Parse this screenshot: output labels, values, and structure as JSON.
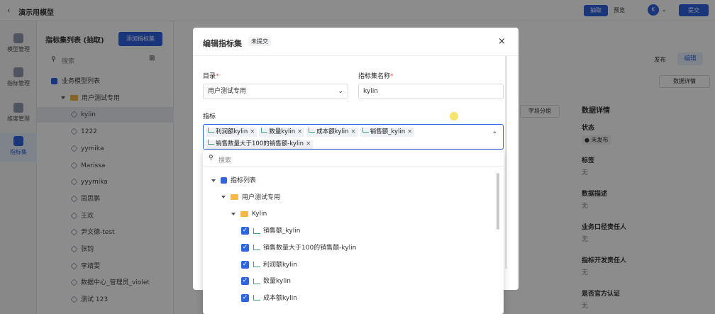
{
  "app": {
    "back_label": "演示用模型",
    "btn_draw": "抽取",
    "btn_preview": "预览",
    "avatar": "K",
    "btn_submit": "提交"
  },
  "rail": [
    {
      "label": "模型管理",
      "icon": "model-icon"
    },
    {
      "label": "指标管理",
      "icon": "metric-icon"
    },
    {
      "label": "维度管理",
      "icon": "dimension-icon"
    },
    {
      "label": "指标集",
      "icon": "metric-set-icon",
      "active": true
    }
  ],
  "panel": {
    "title": "指标集列表 (抽取)",
    "add_button": "添加指标集",
    "search_placeholder": "搜索",
    "tree": [
      {
        "label": "业务模型列表",
        "level": 0,
        "kind": "root"
      },
      {
        "label": "用户测试专用",
        "level": 1,
        "kind": "folder"
      },
      {
        "label": "kylin",
        "level": 2,
        "kind": "item",
        "selected": true
      },
      {
        "label": "1222",
        "level": 2,
        "kind": "item"
      },
      {
        "label": "yymika",
        "level": 2,
        "kind": "item"
      },
      {
        "label": "Marissa",
        "level": 2,
        "kind": "item"
      },
      {
        "label": "yyymika",
        "level": 2,
        "kind": "item"
      },
      {
        "label": "周思鹏",
        "level": 2,
        "kind": "item"
      },
      {
        "label": "王欢",
        "level": 2,
        "kind": "item"
      },
      {
        "label": "尹文德-test",
        "level": 2,
        "kind": "item"
      },
      {
        "label": "张钧",
        "level": 2,
        "kind": "item"
      },
      {
        "label": "李靖雯",
        "level": 2,
        "kind": "item"
      },
      {
        "label": "数据中心_管理员_violet",
        "level": 2,
        "kind": "item"
      },
      {
        "label": "测试 123",
        "level": 2,
        "kind": "item"
      }
    ]
  },
  "main": {
    "publish_label": "发布",
    "edit_label": "编辑",
    "data_detail_btn": "数据详情",
    "field_group_btn": "字段分组",
    "detail_title": "数据详情",
    "status_label": "状态",
    "status_value": "未发布",
    "fields": [
      {
        "label": "标签",
        "value": "无"
      },
      {
        "label": "数据描述",
        "value": "无"
      },
      {
        "label": "业务口径责任人",
        "value": "无"
      },
      {
        "label": "指标开发责任人",
        "value": "无"
      },
      {
        "label": "是否官方认证",
        "value": "无"
      }
    ]
  },
  "modal": {
    "title": "编辑指标集",
    "badge": "未提交",
    "dir_label": "目录",
    "dir_value": "用户测试专用",
    "name_label": "指标集名称",
    "name_value": "kylin",
    "metric_label": "指标",
    "chips": [
      "利润额kylin",
      "数量kylin",
      "成本额kylin",
      "销售额_kylin",
      "销售数量大于100的销售额-kylin"
    ],
    "dropdown": {
      "search_placeholder": "搜索",
      "tree": [
        {
          "label": "指标列表",
          "level": 0,
          "kind": "root"
        },
        {
          "label": "用户测试专用",
          "level": 1,
          "kind": "folder"
        },
        {
          "label": "Kylin",
          "level": 2,
          "kind": "folder"
        },
        {
          "label": "销售额_kylin",
          "level": 3,
          "kind": "metric"
        },
        {
          "label": "销售数量大于100的销售额-kylin",
          "level": 3,
          "kind": "metric"
        },
        {
          "label": "利润额kylin",
          "level": 3,
          "kind": "metric"
        },
        {
          "label": "数量kylin",
          "level": 3,
          "kind": "metric"
        },
        {
          "label": "成本额kylin",
          "level": 3,
          "kind": "metric"
        }
      ]
    }
  }
}
